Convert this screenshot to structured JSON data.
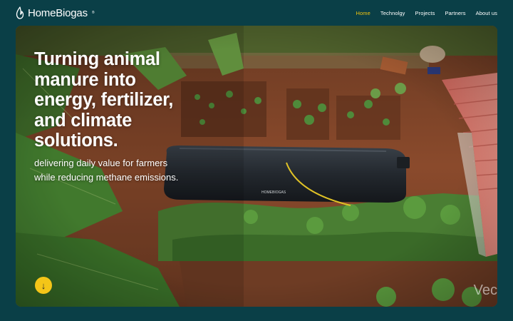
{
  "brand": {
    "name": "HomeBiogas",
    "registered_mark": "®"
  },
  "nav": {
    "items": [
      {
        "label": "Home",
        "active": true
      },
      {
        "label": "Technolgy",
        "active": false
      },
      {
        "label": "Projects",
        "active": false
      },
      {
        "label": "Partners",
        "active": false
      },
      {
        "label": "About us",
        "active": false
      }
    ]
  },
  "hero": {
    "title_lines": [
      "Turning animal",
      "manure into",
      "energy, fertilizer,",
      "and climate",
      "solutions."
    ],
    "subtitle_lines": [
      "delivering daily value for farmers",
      "while reducing methane emissions."
    ],
    "scroll_icon": "arrow-down-icon",
    "tank_label": "HOMEBIOGAS",
    "watermark": "Vec"
  },
  "colors": {
    "background": "#0a3f47",
    "nav_active": "#f1c40f",
    "scroll_button": "#f4c518",
    "text": "#ffffff"
  }
}
